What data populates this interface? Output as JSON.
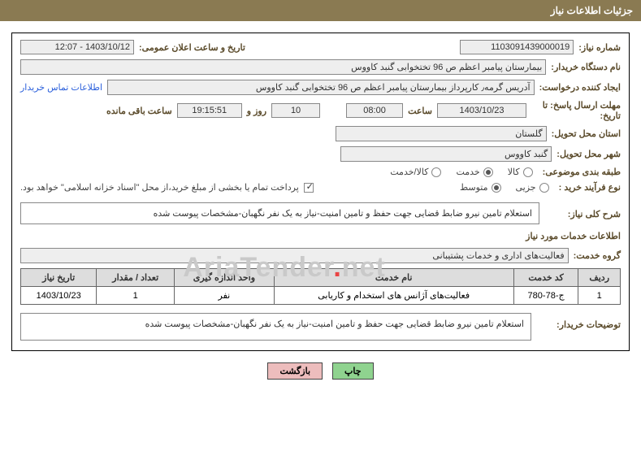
{
  "title": "جزئیات اطلاعات نیاز",
  "number": {
    "label": "شماره نیاز:",
    "value": "1103091439000019"
  },
  "announce": {
    "label": "تاریخ و ساعت اعلان عمومی:",
    "value": "1403/10/12 - 12:07"
  },
  "buyer": {
    "label": "نام دستگاه خریدار:",
    "value": "بیمارستان پیامبر اعظم ص 96 تختخوابی گنبد کاووس"
  },
  "requester": {
    "label": "ایجاد کننده درخواست:",
    "value": "آدریس گرمه٫ کارپرداز بیمارستان پیامبر اعظم ص 96 تختخوابی گنبد کاووس",
    "contact_link": "اطلاعات تماس خریدار"
  },
  "deadline": {
    "label": "مهلت ارسال پاسخ: تا تاریخ:",
    "date": "1403/10/23",
    "time_label": "ساعت",
    "time": "08:00",
    "days_value": "10",
    "days_label": "روز و",
    "remain": "19:15:51",
    "remain_label": "ساعت باقی مانده"
  },
  "province": {
    "label": "استان محل تحویل:",
    "value": "گلستان"
  },
  "city": {
    "label": "شهر محل تحویل:",
    "value": "گنبد کاووس"
  },
  "category": {
    "label": "طبقه بندی موضوعی:",
    "options": [
      "کالا",
      "خدمت",
      "کالا/خدمت"
    ],
    "selected": "خدمت"
  },
  "process": {
    "label": "نوع فرآیند خرید :",
    "options": [
      "جزیی",
      "متوسط"
    ],
    "selected": "متوسط",
    "note": "پرداخت تمام یا بخشی از مبلغ خرید،از محل \"اسناد خزانه اسلامی\" خواهد بود."
  },
  "desc": {
    "label": "شرح کلی نیاز:",
    "text": "استعلام تامین نیرو ضابط قضایی جهت حفظ و تامین امنیت-نیاز به یک نفر نگهبان-مشخصات پیوست شده"
  },
  "services_info_title": "اطلاعات خدمات مورد نیاز",
  "group": {
    "label": "گروه خدمت:",
    "value": "فعالیت‌های اداری و خدمات پشتیبانی"
  },
  "table": {
    "headers": [
      "ردیف",
      "کد خدمت",
      "نام خدمت",
      "واحد اندازه گیری",
      "تعداد / مقدار",
      "تاریخ نیاز"
    ],
    "row": {
      "idx": "1",
      "code": "ج-78-780",
      "name": "فعالیت‌های آژانس های استخدام و کاریابی",
      "unit": "نفر",
      "qty": "1",
      "date": "1403/10/23"
    }
  },
  "buyer_notes": {
    "label": "توضیحات خریدار:",
    "text": "استعلام تامین نیرو ضابط قضایی جهت حفظ و تامین امنیت-نیاز به یک نفر نگهبان-مشخصات پیوست شده"
  },
  "buttons": {
    "print": "چاپ",
    "back": "بازگشت"
  },
  "watermark": {
    "brand_a": "Aria",
    "brand_b": "Tender",
    "brand_c": "net"
  }
}
